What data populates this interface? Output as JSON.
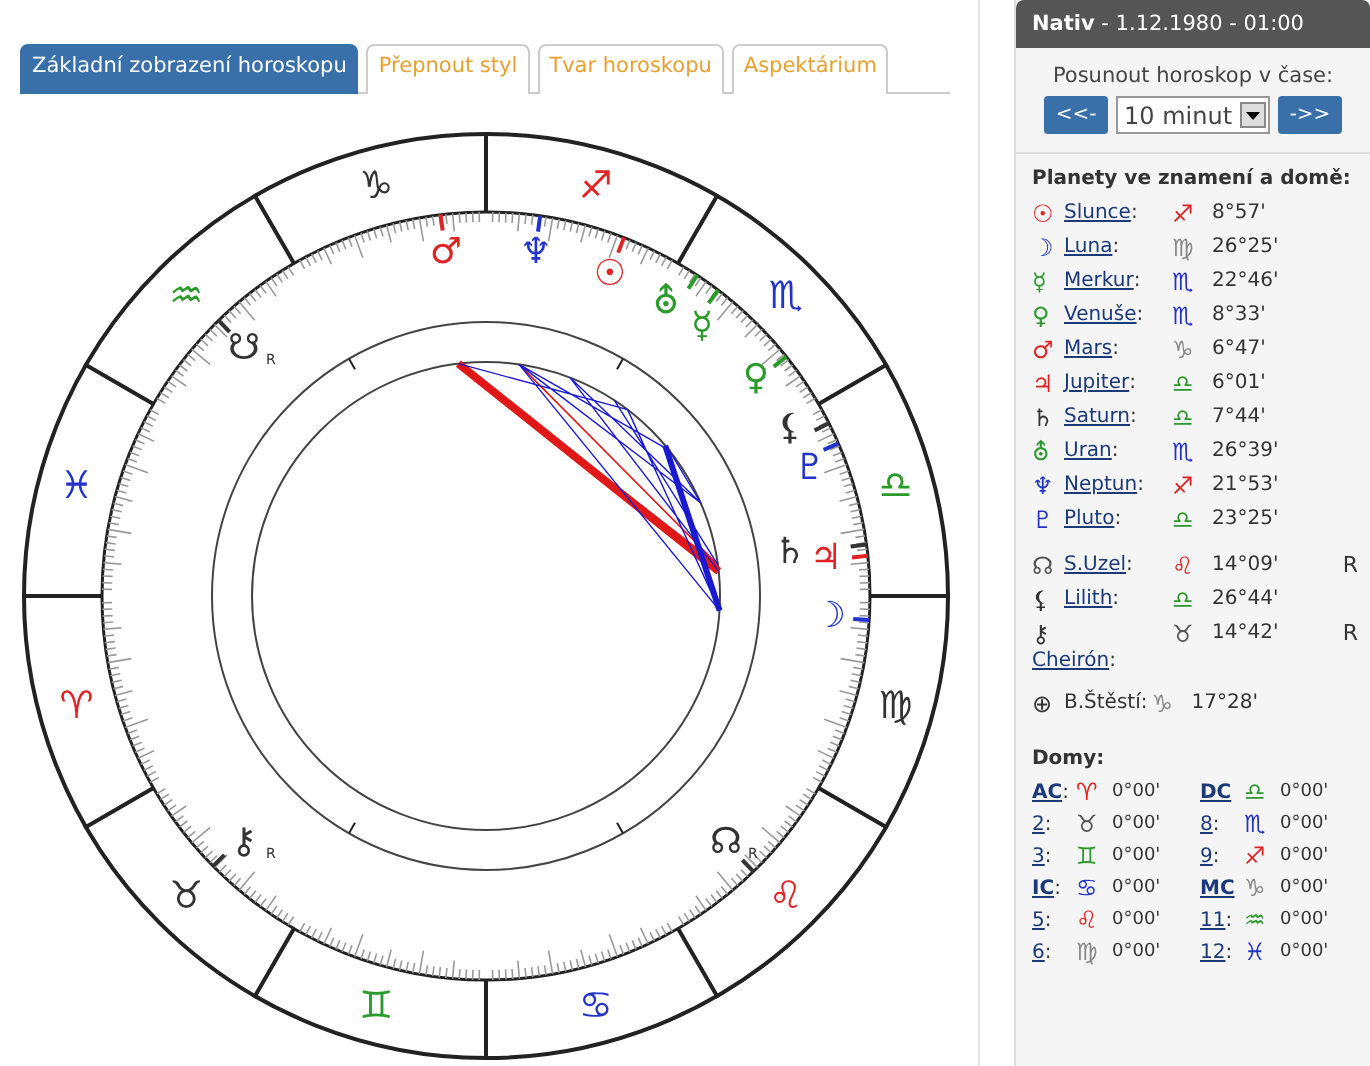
{
  "tabs": [
    {
      "label": "Základní zobrazení horoskopu",
      "selected": true
    },
    {
      "label": "Přepnout styl",
      "selected": false
    },
    {
      "label": "Tvar horoskopu",
      "selected": false
    },
    {
      "label": "Aspektárium",
      "selected": false
    }
  ],
  "chart": {
    "signs": [
      {
        "glyph": "♈",
        "color": "#e02424"
      },
      {
        "glyph": "♉",
        "color": "#333333"
      },
      {
        "glyph": "♊",
        "color": "#2a9a2a"
      },
      {
        "glyph": "♋",
        "color": "#2233cc"
      },
      {
        "glyph": "♌",
        "color": "#e02424"
      },
      {
        "glyph": "♍",
        "color": "#333333"
      },
      {
        "glyph": "♎",
        "color": "#2a9a2a"
      },
      {
        "glyph": "♏",
        "color": "#2233cc"
      },
      {
        "glyph": "♐",
        "color": "#e02424"
      },
      {
        "glyph": "♑",
        "color": "#333333"
      },
      {
        "glyph": "♒",
        "color": "#2a9a2a"
      },
      {
        "glyph": "♓",
        "color": "#2233cc"
      }
    ],
    "planets": [
      {
        "glyph": "♂",
        "color": "#e02424"
      },
      {
        "glyph": "♆",
        "color": "#2233cc"
      },
      {
        "glyph": "☉",
        "color": "#e02424"
      },
      {
        "glyph": "⛢",
        "color": "#2a9a2a"
      },
      {
        "glyph": "☿",
        "color": "#2a9a2a"
      },
      {
        "glyph": "☋",
        "color": "#333333",
        "mark": "R"
      },
      {
        "glyph": "♀",
        "color": "#2a9a2a"
      },
      {
        "glyph": "⚸",
        "color": "#333333"
      },
      {
        "glyph": "♇",
        "color": "#2233cc"
      },
      {
        "glyph": "♄",
        "color": "#333333"
      },
      {
        "glyph": "♃",
        "color": "#e02424"
      },
      {
        "glyph": "☽",
        "color": "#2233cc"
      },
      {
        "glyph": "⚷",
        "color": "#333333",
        "mark": "R"
      },
      {
        "glyph": "☊",
        "color": "#333333",
        "mark": "R"
      }
    ]
  },
  "sidebar": {
    "header": "**Nativ** - 1.12.1980 - 01:00",
    "shift_label": "Posunout horoskop v čase:",
    "back_button": "<<-",
    "step": "10 minut",
    "forward_button": "->>",
    "planets_title": "Planety ve znamení a domě:",
    "planets": [
      {
        "icon": {
          "glyph": "☉",
          "color": "#e02424"
        },
        "name": "Slunce",
        "suffix": ":",
        "sign": {
          "glyph": "♐",
          "color": "#e02424"
        },
        "degree": "8°57'"
      },
      {
        "icon": {
          "glyph": "☽",
          "color": "#2233cc"
        },
        "name": "Luna",
        "suffix": ":",
        "sign": {
          "glyph": "♍",
          "color": "#888888"
        },
        "degree": "26°25'"
      },
      {
        "icon": {
          "glyph": "☿",
          "color": "#2a9a2a"
        },
        "name": "Merkur",
        "suffix": ":",
        "sign": {
          "glyph": "♏",
          "color": "#2233cc"
        },
        "degree": "22°46'"
      },
      {
        "icon": {
          "glyph": "♀",
          "color": "#2a9a2a"
        },
        "name": "Venuše",
        "suffix": ":",
        "sign": {
          "glyph": "♏",
          "color": "#2233cc"
        },
        "degree": "8°33'"
      },
      {
        "icon": {
          "glyph": "♂",
          "color": "#e02424"
        },
        "name": "Mars",
        "suffix": ":",
        "sign": {
          "glyph": "♑",
          "color": "#888888"
        },
        "degree": "6°47'"
      },
      {
        "icon": {
          "glyph": "♃",
          "color": "#e02424"
        },
        "name": "Jupiter",
        "suffix": ":",
        "sign": {
          "glyph": "♎",
          "color": "#2a9a2a"
        },
        "degree": "6°01'"
      },
      {
        "icon": {
          "glyph": "♄",
          "color": "#333333"
        },
        "name": "Saturn",
        "suffix": ":",
        "sign": {
          "glyph": "♎",
          "color": "#2a9a2a"
        },
        "degree": "7°44'"
      },
      {
        "icon": {
          "glyph": "⛢",
          "color": "#2a9a2a"
        },
        "name": "Uran",
        "suffix": ":",
        "sign": {
          "glyph": "♏",
          "color": "#2233cc"
        },
        "degree": "26°39'"
      },
      {
        "icon": {
          "glyph": "♆",
          "color": "#2233cc"
        },
        "name": "Neptun",
        "suffix": ":",
        "sign": {
          "glyph": "♐",
          "color": "#e02424"
        },
        "degree": "21°53'"
      },
      {
        "icon": {
          "glyph": "♇",
          "color": "#2233cc"
        },
        "name": "Pluto",
        "suffix": ":",
        "sign": {
          "glyph": "♎",
          "color": "#2a9a2a"
        },
        "degree": "23°25'"
      }
    ],
    "points": [
      {
        "icon": {
          "glyph": "☊",
          "color": "#555555"
        },
        "name": "S.Uzel",
        "suffix": ":",
        "sign": {
          "glyph": "♌",
          "color": "#e02424"
        },
        "degree": "14°09'",
        "retro": "R"
      },
      {
        "icon": {
          "glyph": "⚸",
          "color": "#333333"
        },
        "name": "Lilith",
        "suffix": ":",
        "sign": {
          "glyph": "♎",
          "color": "#2a9a2a"
        },
        "degree": "26°44'"
      },
      {
        "icon": {
          "glyph": "⚷",
          "color": "#333333"
        },
        "name": "Cheirón",
        "suffix": ":",
        "sign": {
          "glyph": "♉",
          "color": "#555555"
        },
        "degree": "14°42'",
        "retro": "R",
        "wrap": true
      }
    ],
    "fortune": {
      "icon": "⊕",
      "label": "B.Štěstí:",
      "sign": {
        "glyph": "♑",
        "color": "#888888"
      },
      "degree": "17°28'"
    },
    "houses_title": "Domy:",
    "houses": [
      {
        "label": "AC",
        "bold": true,
        "suffix": ":",
        "sign": {
          "glyph": "♈",
          "color": "#e02424"
        },
        "degree": "0°00'"
      },
      {
        "label": "DC",
        "bold": true,
        "sign": {
          "glyph": "♎",
          "color": "#2a9a2a"
        },
        "degree": "0°00'"
      },
      {
        "label": "2",
        "bold": false,
        "suffix": ":",
        "sign": {
          "glyph": "♉",
          "color": "#555555"
        },
        "degree": "0°00'"
      },
      {
        "label": "8",
        "bold": false,
        "suffix": ":",
        "sign": {
          "glyph": "♏",
          "color": "#2233cc"
        },
        "degree": "0°00'"
      },
      {
        "label": "3",
        "bold": false,
        "suffix": ":",
        "sign": {
          "glyph": "♊",
          "color": "#2a9a2a"
        },
        "degree": "0°00'"
      },
      {
        "label": "9",
        "bold": false,
        "suffix": ":",
        "sign": {
          "glyph": "♐",
          "color": "#e02424"
        },
        "degree": "0°00'"
      },
      {
        "label": "IC",
        "bold": true,
        "suffix": ":",
        "sign": {
          "glyph": "♋",
          "color": "#2233cc"
        },
        "degree": "0°00'"
      },
      {
        "label": "MC",
        "bold": true,
        "sign": {
          "glyph": "♑",
          "color": "#888888"
        },
        "degree": "0°00'"
      },
      {
        "label": "5",
        "bold": false,
        "suffix": ":",
        "sign": {
          "glyph": "♌",
          "color": "#e02424"
        },
        "degree": "0°00'"
      },
      {
        "label": "11",
        "bold": false,
        "suffix": ":",
        "sign": {
          "glyph": "♒",
          "color": "#2a9a2a"
        },
        "degree": "0°00'"
      },
      {
        "label": "6",
        "bold": false,
        "suffix": ":",
        "sign": {
          "glyph": "♍",
          "color": "#888888"
        },
        "degree": "0°00'"
      },
      {
        "label": "12",
        "bold": false,
        "suffix": ":",
        "sign": {
          "glyph": "♓",
          "color": "#2233cc"
        },
        "degree": "0°00'"
      }
    ]
  }
}
